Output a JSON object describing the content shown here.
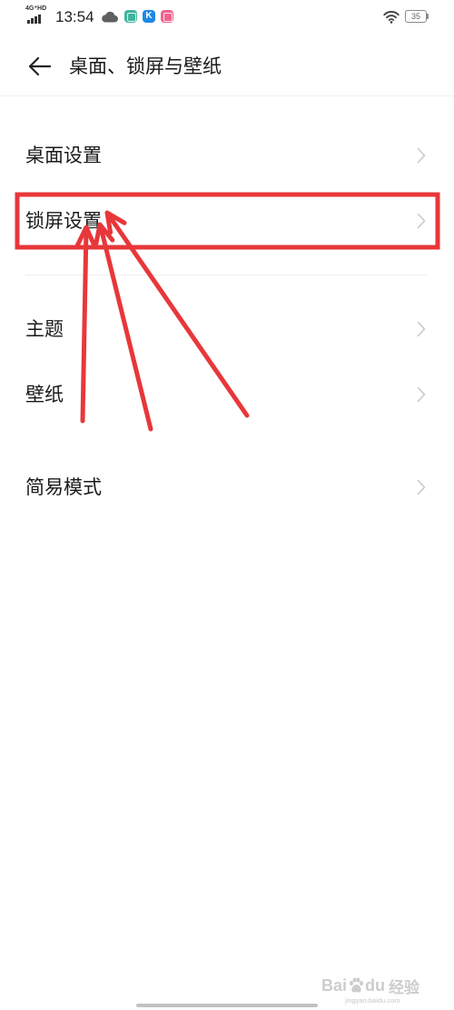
{
  "status_bar": {
    "network_label": "4G⁺HD",
    "time": "13:54",
    "battery_level": "35",
    "icons": {
      "signal": "signal-bars-icon",
      "weather": "cloud-icon",
      "apps": [
        {
          "name": "app-notification-icon",
          "color": "#3fb59e"
        },
        {
          "name": "k-app-icon",
          "glyph": "K",
          "color": "#1e88e5"
        },
        {
          "name": "app-notification-icon-2",
          "color": "#f0648c"
        }
      ],
      "wifi": "wifi-icon",
      "battery": "battery-icon"
    }
  },
  "header": {
    "back_icon": "back-arrow-icon",
    "title": "桌面、锁屏与壁纸"
  },
  "sections": [
    {
      "items": [
        {
          "label": "桌面设置"
        },
        {
          "label": "锁屏设置"
        }
      ]
    },
    {
      "items": [
        {
          "label": "主题"
        },
        {
          "label": "壁纸"
        }
      ]
    },
    {
      "items": [
        {
          "label": "简易模式"
        }
      ]
    }
  ],
  "annotation": {
    "color": "#e8373a"
  },
  "watermark": {
    "brand_left": "Bai",
    "brand_right": "du",
    "brand_cn": "经验",
    "url": "jingyan.baidu.com"
  },
  "theme": {
    "text": "#1a1a1a",
    "chevron": "#c7c7c7",
    "divider": "#eeeeee",
    "background": "#ffffff"
  }
}
